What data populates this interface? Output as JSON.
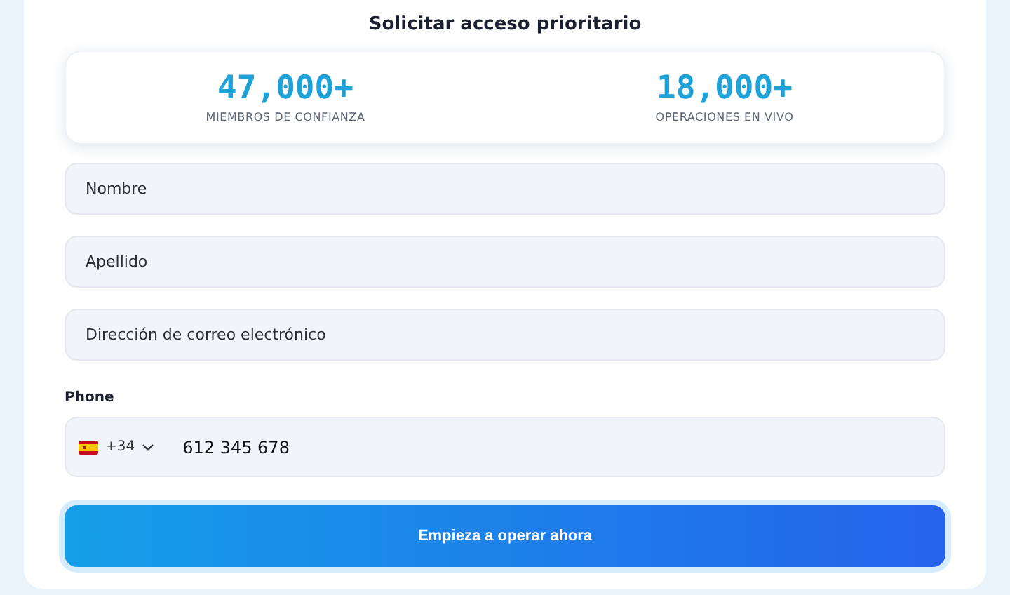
{
  "title": "Solicitar acceso prioritario",
  "stats": [
    {
      "value": "47,000+",
      "label": "MIEMBROS DE CONFIANZA"
    },
    {
      "value": "18,000+",
      "label": "OPERACIONES EN VIVO"
    }
  ],
  "fields": [
    {
      "placeholder": "Nombre"
    },
    {
      "placeholder": "Apellido"
    },
    {
      "placeholder": "Dirección de correo electrónico"
    }
  ],
  "phone": {
    "label": "Phone",
    "country_code": "+34",
    "value": "612 345 678"
  },
  "submit": "Empieza a operar ahora"
}
